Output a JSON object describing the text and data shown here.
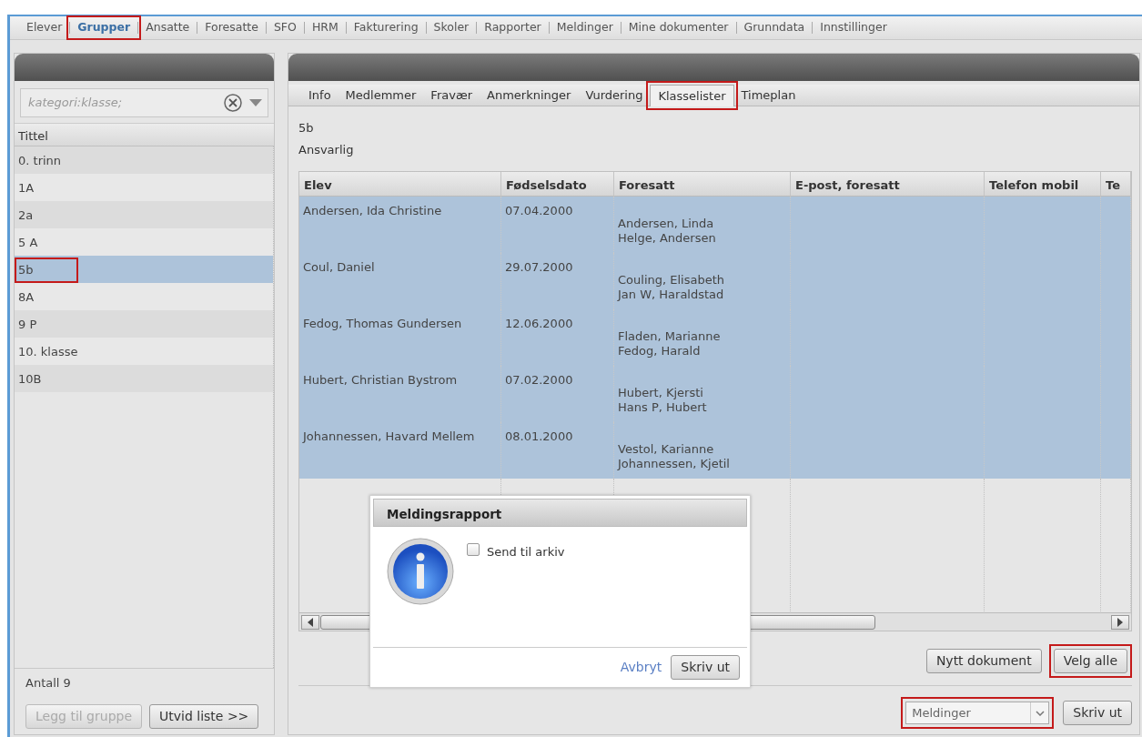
{
  "top_nav": [
    {
      "label": "Elever",
      "selected": false,
      "highlighted": false
    },
    {
      "label": "Grupper",
      "selected": true,
      "highlighted": true
    },
    {
      "label": "Ansatte",
      "selected": false,
      "highlighted": false
    },
    {
      "label": "Foresatte",
      "selected": false,
      "highlighted": false
    },
    {
      "label": "SFO",
      "selected": false,
      "highlighted": false
    },
    {
      "label": "HRM",
      "selected": false,
      "highlighted": false
    },
    {
      "label": "Fakturering",
      "selected": false,
      "highlighted": false
    },
    {
      "label": "Skoler",
      "selected": false,
      "highlighted": false
    },
    {
      "label": "Rapporter",
      "selected": false,
      "highlighted": false
    },
    {
      "label": "Meldinger",
      "selected": false,
      "highlighted": false
    },
    {
      "label": "Mine dokumenter",
      "selected": false,
      "highlighted": false
    },
    {
      "label": "Grunndata",
      "selected": false,
      "highlighted": false
    },
    {
      "label": "Innstillinger",
      "selected": false,
      "highlighted": false
    }
  ],
  "group_panel": {
    "search": {
      "value": "kategori:klasse;"
    },
    "column": "Tittel",
    "items": [
      {
        "label": "0. trinn",
        "selected": false,
        "highlighted": false
      },
      {
        "label": "1A",
        "selected": false,
        "highlighted": false
      },
      {
        "label": "2a",
        "selected": false,
        "highlighted": false
      },
      {
        "label": "5 A",
        "selected": false,
        "highlighted": false
      },
      {
        "label": "5b",
        "selected": true,
        "highlighted": true
      },
      {
        "label": "8A",
        "selected": false,
        "highlighted": false
      },
      {
        "label": "9 P",
        "selected": false,
        "highlighted": false
      },
      {
        "label": "10. klasse",
        "selected": false,
        "highlighted": false
      },
      {
        "label": "10B",
        "selected": false,
        "highlighted": false
      }
    ],
    "count": "Antall 9",
    "buttons": [
      {
        "label": "Legg til gruppe",
        "disabled": true
      },
      {
        "label": "Utvid liste >>",
        "disabled": false
      }
    ]
  },
  "detail_panel": {
    "tabs": [
      {
        "label": "Info",
        "selected": false,
        "highlighted": false
      },
      {
        "label": "Medlemmer",
        "selected": false,
        "highlighted": false
      },
      {
        "label": "Fravær",
        "selected": false,
        "highlighted": false
      },
      {
        "label": "Anmerkninger",
        "selected": false,
        "highlighted": false
      },
      {
        "label": "Vurdering",
        "selected": false,
        "highlighted": false
      },
      {
        "label": "Klasselister",
        "selected": true,
        "highlighted": true
      },
      {
        "label": "Timeplan",
        "selected": false,
        "highlighted": false
      }
    ],
    "group_name": "5b",
    "responsible": "Ansvarlig",
    "table": {
      "columns": [
        "Elev",
        "Fødselsdato",
        "Foresatt",
        "E-post, foresatt",
        "Telefon mobil",
        "Te"
      ],
      "rows": [
        {
          "selected": true,
          "elev": "Andersen, Ida Christine",
          "fodselsdato": "07.04.2000",
          "foresatt": [
            "Andersen, Linda",
            "Helge, Andersen"
          ]
        },
        {
          "selected": true,
          "elev": "Coul, Daniel",
          "fodselsdato": "29.07.2000",
          "foresatt": [
            "Couling, Elisabeth",
            "Jan W, Haraldstad"
          ]
        },
        {
          "selected": true,
          "elev": "Fedog, Thomas Gundersen",
          "fodselsdato": "12.06.2000",
          "foresatt": [
            "Fladen, Marianne",
            "Fedog, Harald"
          ]
        },
        {
          "selected": true,
          "elev": "Hubert, Christian Bystrom",
          "fodselsdato": "07.02.2000",
          "foresatt": [
            "Hubert, Kjersti",
            "Hans P, Hubert"
          ]
        },
        {
          "selected": true,
          "elev": "Johannessen, Havard Mellem",
          "fodselsdato": "08.01.2000",
          "foresatt": [
            "Vestol, Karianne",
            "Johannessen, Kjetil"
          ]
        }
      ]
    },
    "buttons": [
      {
        "label": "Nytt dokument",
        "highlighted": false
      },
      {
        "label": "Velg alle",
        "highlighted": true
      }
    ],
    "report_select": {
      "value": "Meldinger",
      "highlighted": true
    },
    "print_button": "Skriv ut"
  },
  "dialog": {
    "title": "Meldingsrapport",
    "checkbox": {
      "label": "Send til arkiv",
      "checked": false
    },
    "cancel": "Avbryt",
    "confirm": "Skriv ut"
  }
}
